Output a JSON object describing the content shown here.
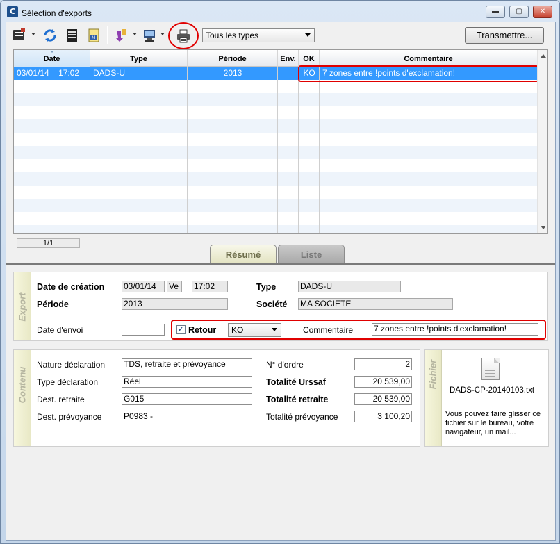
{
  "window": {
    "title": "Sélection d'exports",
    "app_icon_letter": "C",
    "controls": {
      "minimize": "▬",
      "maximize": "▢",
      "close": "✕"
    }
  },
  "toolbar": {
    "icons": [
      "export-list-icon",
      "refresh-icon",
      "document-list-icon",
      "mail-document-icon",
      "import-arrow-icon",
      "computer-export-icon",
      "printer-icon"
    ],
    "type_filter": "Tous les types",
    "transmit_label": "Transmettre..."
  },
  "grid": {
    "columns": [
      "Date",
      "Type",
      "Période",
      "Env.",
      "OK",
      "Commentaire"
    ],
    "rows": [
      {
        "date": "03/01/14",
        "time": "17:02",
        "type": "DADS-U",
        "periode": "2013",
        "env": "",
        "ok": "KO",
        "commentaire": "7 zones entre !points d'exclamation!"
      }
    ]
  },
  "pager": "1/1",
  "tabs": {
    "resume": "Résumé",
    "liste": "Liste"
  },
  "export": {
    "section_label": "Export",
    "date_creation_label": "Date de création",
    "date_creation": "03/01/14",
    "weekday": "Ve",
    "time": "17:02",
    "type_label": "Type",
    "type": "DADS-U",
    "periode_label": "Période",
    "periode": "2013",
    "societe_label": "Société",
    "societe": "MA SOCIETE",
    "date_envoi_label": "Date d'envoi",
    "date_envoi": "",
    "retour_label": "Retour",
    "retour_checked": true,
    "retour_value": "KO",
    "commentaire_label": "Commentaire",
    "commentaire": "7 zones entre !points d'exclamation!"
  },
  "contenu": {
    "section_label": "Contenu",
    "nature_label": "Nature déclaration",
    "nature": "TDS, retraite et prévoyance",
    "type_decl_label": "Type déclaration",
    "type_decl": "Réel",
    "dest_retraite_label": "Dest. retraite",
    "dest_retraite": "G015",
    "dest_prevoyance_label": "Dest. prévoyance",
    "dest_prevoyance": "P0983 -",
    "ordre_label": "N° d'ordre",
    "ordre": "2",
    "urssaf_label": "Totalité Urssaf",
    "urssaf": "20 539,00",
    "retraite_label": "Totalité retraite",
    "retraite": "20 539,00",
    "prevoyance_label": "Totalité prévoyance",
    "prevoyance": "3 100,20"
  },
  "fichier": {
    "section_label": "Fichier",
    "filename": "DADS-CP-20140103.txt",
    "hint": "Vous pouvez faire glisser ce fichier sur le bureau, votre navigateur, un mail..."
  },
  "colors": {
    "selection": "#3399ff",
    "highlight_annotation": "#e00000"
  }
}
